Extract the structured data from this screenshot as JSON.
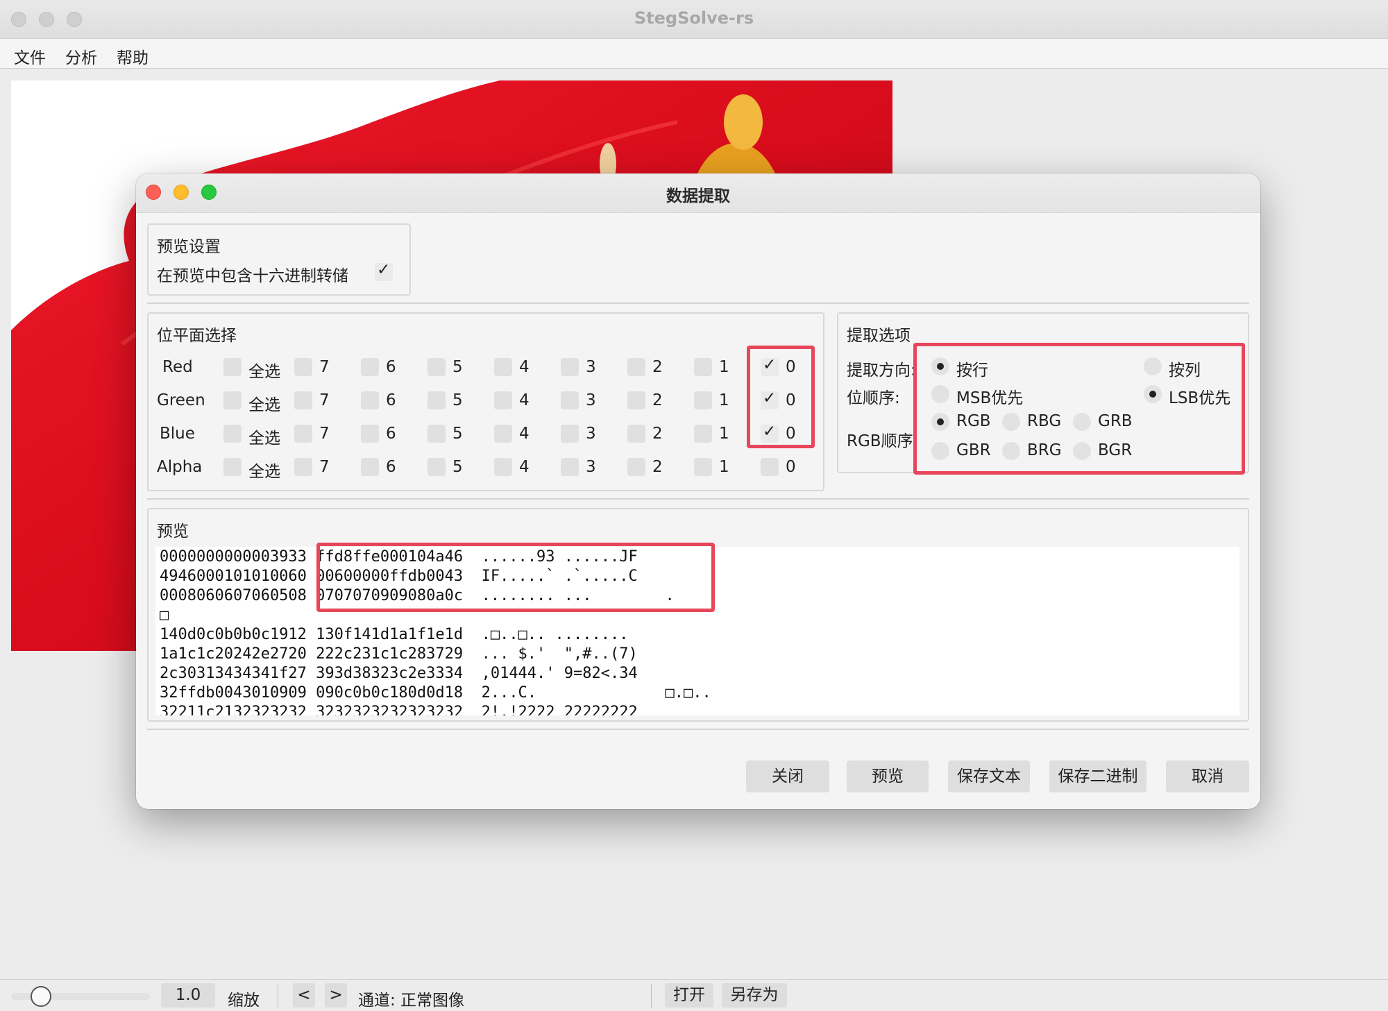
{
  "app": {
    "title": "StegSolve-rs"
  },
  "menu": [
    "文件",
    "分析",
    "帮助"
  ],
  "statusbar": {
    "zoom_value": "1.0",
    "zoom_label": "缩放",
    "prev": "<",
    "next": ">",
    "channel": "通道: 正常图像",
    "open": "打开",
    "save_as": "另存为"
  },
  "dialog": {
    "title": "数据提取",
    "preview_settings": {
      "title": "预览设置",
      "hex_dump_label": "在预览中包含十六进制转储",
      "hex_dump_checked": true
    },
    "bitplane": {
      "title": "位平面选择",
      "select_all": "全选",
      "bits": [
        "7",
        "6",
        "5",
        "4",
        "3",
        "2",
        "1",
        "0"
      ],
      "channels": [
        {
          "name": "Red",
          "bit0_checked": true
        },
        {
          "name": "Green",
          "bit0_checked": true
        },
        {
          "name": "Blue",
          "bit0_checked": true
        },
        {
          "name": "Alpha",
          "bit0_checked": false
        }
      ],
      "check_mark": "✓"
    },
    "extract": {
      "title": "提取选项",
      "direction_label": "提取方向:",
      "by_row": "按行",
      "by_col": "按列",
      "bit_order_label": "位顺序:",
      "msb": "MSB优先",
      "lsb": "LSB优先",
      "rgb_order_label": "RGB顺序:",
      "orders": [
        "RGB",
        "RBG",
        "GRB",
        "GBR",
        "BRG",
        "BGR"
      ],
      "selected_direction": "按行",
      "selected_bit_order": "LSB优先",
      "selected_rgb": "RGB"
    },
    "preview": {
      "title": "预览",
      "lines": [
        "0000000000003933 ffd8ffe000104a46  ......93 ......JF",
        "4946000101010060 00600000ffdb0043  IF.....` .`.....C",
        "0008060607060508 0707070909080a0c  ........ ...        .",
        "□",
        "140d0c0b0b0c1912 130f141d1a1f1e1d  .□..□.. ........",
        "1a1c1c20242e2720 222c231c1c283729  ... $.'  \",#..(7)",
        "2c30313434341f27 393d38323c2e3334  ,01444.' 9=82<.34",
        "32ffdb0043010909 090c0b0c180d0d18  2...C.              □.□..",
        "32211c2132323232 3232323232323232  2!.!2222 22222222"
      ]
    },
    "buttons": {
      "close": "关闭",
      "preview": "预览",
      "save_text": "保存文本",
      "save_binary": "保存二进制",
      "cancel": "取消"
    }
  },
  "colors": {
    "highlight_box": "#e8465a",
    "flag_red": "#e01020",
    "flag_gold": "#e8a020"
  }
}
